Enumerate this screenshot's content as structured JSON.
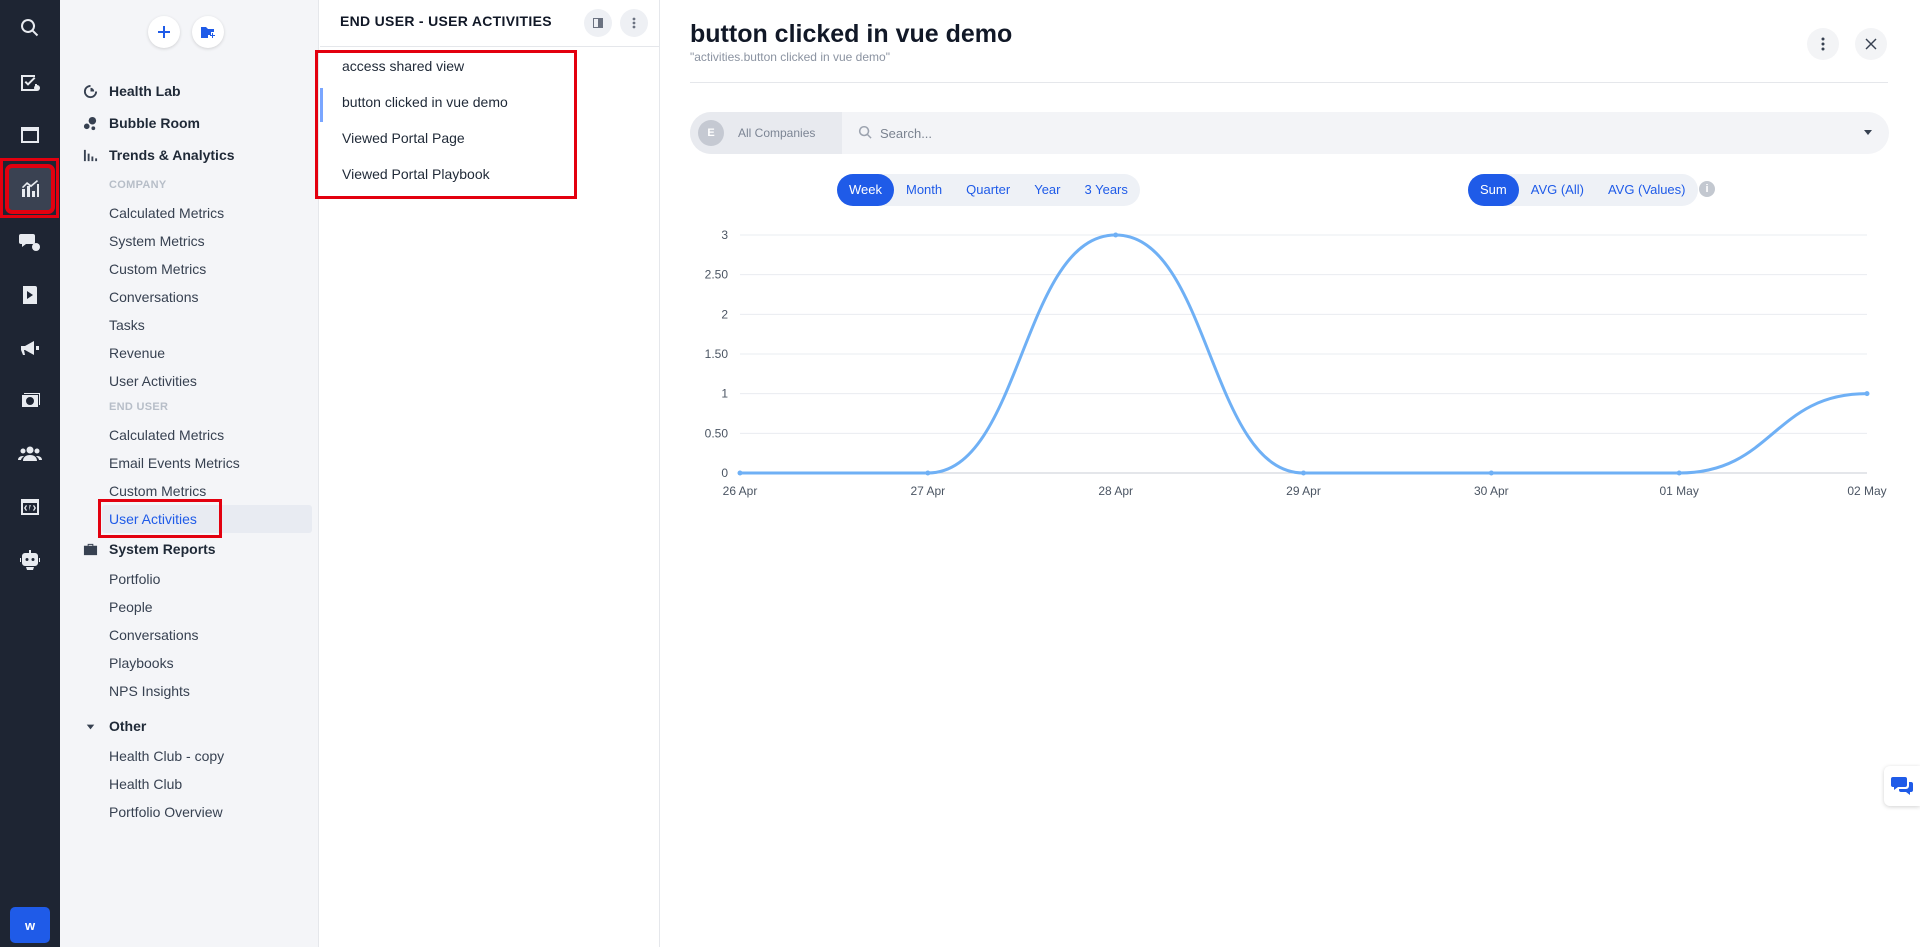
{
  "rail": {
    "icons": [
      "search-icon",
      "tasks-icon",
      "layout-icon",
      "analytics-icon",
      "conversations-icon",
      "playbook-icon",
      "announce-icon",
      "billing-icon",
      "people-icon",
      "code-icon",
      "bot-icon"
    ],
    "active": "analytics-icon",
    "avatar_letter": "w"
  },
  "nav": {
    "groups": [
      {
        "label": "Health Lab",
        "icon": "health-lab-icon"
      },
      {
        "label": "Bubble Room",
        "icon": "bubble-room-icon"
      },
      {
        "label": "Trends & Analytics",
        "icon": "bar-chart-icon"
      },
      {
        "label": "System Reports",
        "icon": "briefcase-icon"
      },
      {
        "label": "Other",
        "icon": "caret-down-icon"
      }
    ],
    "sections": {
      "company": "COMPANY",
      "end_user": "END USER"
    },
    "company_items": [
      "Calculated Metrics",
      "System Metrics",
      "Custom Metrics",
      "Conversations",
      "Tasks",
      "Revenue",
      "User Activities"
    ],
    "end_user_items": [
      "Calculated Metrics",
      "Email Events Metrics",
      "Custom Metrics",
      "User Activities"
    ],
    "system_reports_items": [
      "Portfolio",
      "People",
      "Conversations",
      "Playbooks",
      "NPS Insights"
    ],
    "other_items": [
      "Health Club - copy",
      "Health Club",
      "Portfolio Overview"
    ]
  },
  "list_panel": {
    "title": "END USER - USER ACTIVITIES",
    "items": [
      "access shared view",
      "button clicked in vue demo",
      "Viewed Portal Page",
      "Viewed Portal Playbook"
    ],
    "selected_index": 1
  },
  "main": {
    "title": "button clicked in vue demo",
    "subtitle": "\"activities.button clicked in vue demo\"",
    "filter": {
      "company_badge": "E",
      "company_label": "All Companies",
      "search_placeholder": "Search..."
    },
    "periods": [
      "Week",
      "Month",
      "Quarter",
      "Year",
      "3 Years"
    ],
    "period_selected": "Week",
    "aggregations": [
      "Sum",
      "AVG (All)",
      "AVG (Values)"
    ],
    "aggregation_selected": "Sum",
    "info_glyph": "i"
  },
  "colors": {
    "accent": "#1f5be8",
    "rail_bg": "#1e2533",
    "line": "#6fb0f5",
    "highlight_box": "#e3000f"
  },
  "chart_data": {
    "type": "line",
    "categories": [
      "26 Apr",
      "27 Apr",
      "28 Apr",
      "29 Apr",
      "30 Apr",
      "01 May",
      "02 May"
    ],
    "series": [
      {
        "values": [
          0,
          0,
          3,
          0,
          0,
          0,
          1
        ]
      }
    ],
    "ylim": [
      0,
      3
    ],
    "yticks": [
      0,
      0.5,
      1,
      1.5,
      2,
      2.5,
      3
    ],
    "ytick_labels": [
      "0",
      "0.50",
      "1",
      "1.50",
      "2",
      "2.50",
      "3"
    ],
    "grid": true,
    "smooth": true
  }
}
